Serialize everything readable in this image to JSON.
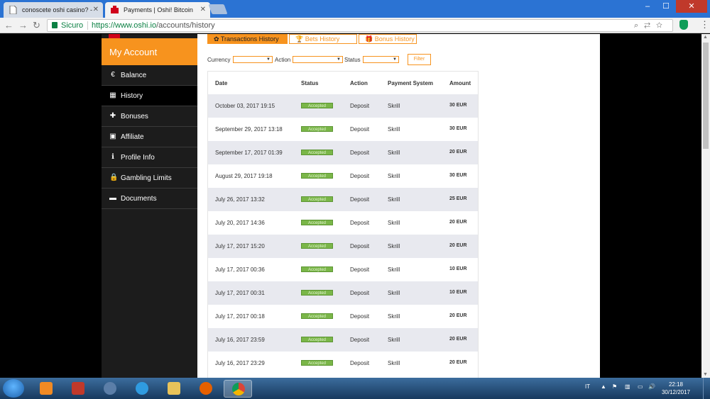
{
  "browser": {
    "tabs": [
      {
        "title": "conoscete oshi casino? -"
      },
      {
        "title": "Payments | Oshi! Bitcoin"
      }
    ],
    "address": {
      "secure_label": "Sicuro",
      "url_prefix": "https://www.oshi.io",
      "url_path": "/accounts/history"
    },
    "window_buttons": {
      "minimize": "–",
      "maximize": "☐",
      "close": "✕"
    }
  },
  "sidebar": {
    "title": "My Account",
    "items": [
      {
        "label": "Balance",
        "icon": "€"
      },
      {
        "label": "History",
        "icon": "▦"
      },
      {
        "label": "Bonuses",
        "icon": "✚"
      },
      {
        "label": "Affiliate",
        "icon": "▣"
      },
      {
        "label": "Profile Info",
        "icon": "ℹ"
      },
      {
        "label": "Gambling Limits",
        "icon": "🔒"
      },
      {
        "label": "Documents",
        "icon": "▬"
      }
    ]
  },
  "history_tabs": [
    {
      "label": "Transactions History",
      "icon": "✿"
    },
    {
      "label": "Bets History",
      "icon": "🏆"
    },
    {
      "label": "Bonus History",
      "icon": "🎁"
    }
  ],
  "filters": {
    "currency_label": "Currency",
    "action_label": "Action",
    "status_label": "Status",
    "filter_button": "Filter"
  },
  "table": {
    "headers": [
      "Date",
      "Status",
      "Action",
      "Payment System",
      "Amount"
    ],
    "rows": [
      {
        "date": "October 03, 2017 19:15",
        "status": "Accepted",
        "action": "Deposit",
        "system": "Skrill",
        "amount": "30 EUR"
      },
      {
        "date": "September 29, 2017 13:18",
        "status": "Accepted",
        "action": "Deposit",
        "system": "Skrill",
        "amount": "30 EUR"
      },
      {
        "date": "September 17, 2017 01:39",
        "status": "Accepted",
        "action": "Deposit",
        "system": "Skrill",
        "amount": "20 EUR"
      },
      {
        "date": "August 29, 2017 19:18",
        "status": "Accepted",
        "action": "Deposit",
        "system": "Skrill",
        "amount": "30 EUR"
      },
      {
        "date": "July 26, 2017 13:32",
        "status": "Accepted",
        "action": "Deposit",
        "system": "Skrill",
        "amount": "25 EUR"
      },
      {
        "date": "July 20, 2017 14:36",
        "status": "Accepted",
        "action": "Deposit",
        "system": "Skrill",
        "amount": "20 EUR"
      },
      {
        "date": "July 17, 2017 15:20",
        "status": "Accepted",
        "action": "Deposit",
        "system": "Skrill",
        "amount": "20 EUR"
      },
      {
        "date": "July 17, 2017 00:36",
        "status": "Accepted",
        "action": "Deposit",
        "system": "Skrill",
        "amount": "10 EUR"
      },
      {
        "date": "July 17, 2017 00:31",
        "status": "Accepted",
        "action": "Deposit",
        "system": "Skrill",
        "amount": "10 EUR"
      },
      {
        "date": "July 17, 2017 00:18",
        "status": "Accepted",
        "action": "Deposit",
        "system": "Skrill",
        "amount": "20 EUR"
      },
      {
        "date": "July 16, 2017 23:59",
        "status": "Accepted",
        "action": "Deposit",
        "system": "Skrill",
        "amount": "20 EUR"
      },
      {
        "date": "July 16, 2017 23:29",
        "status": "Accepted",
        "action": "Deposit",
        "system": "Skrill",
        "amount": "20 EUR"
      }
    ]
  },
  "taskbar": {
    "language": "IT",
    "time": "22:18",
    "date": "30/12/2017"
  },
  "colors": {
    "accent": "#f7931e",
    "badge": "#7ab648",
    "secure": "#0b8043"
  }
}
